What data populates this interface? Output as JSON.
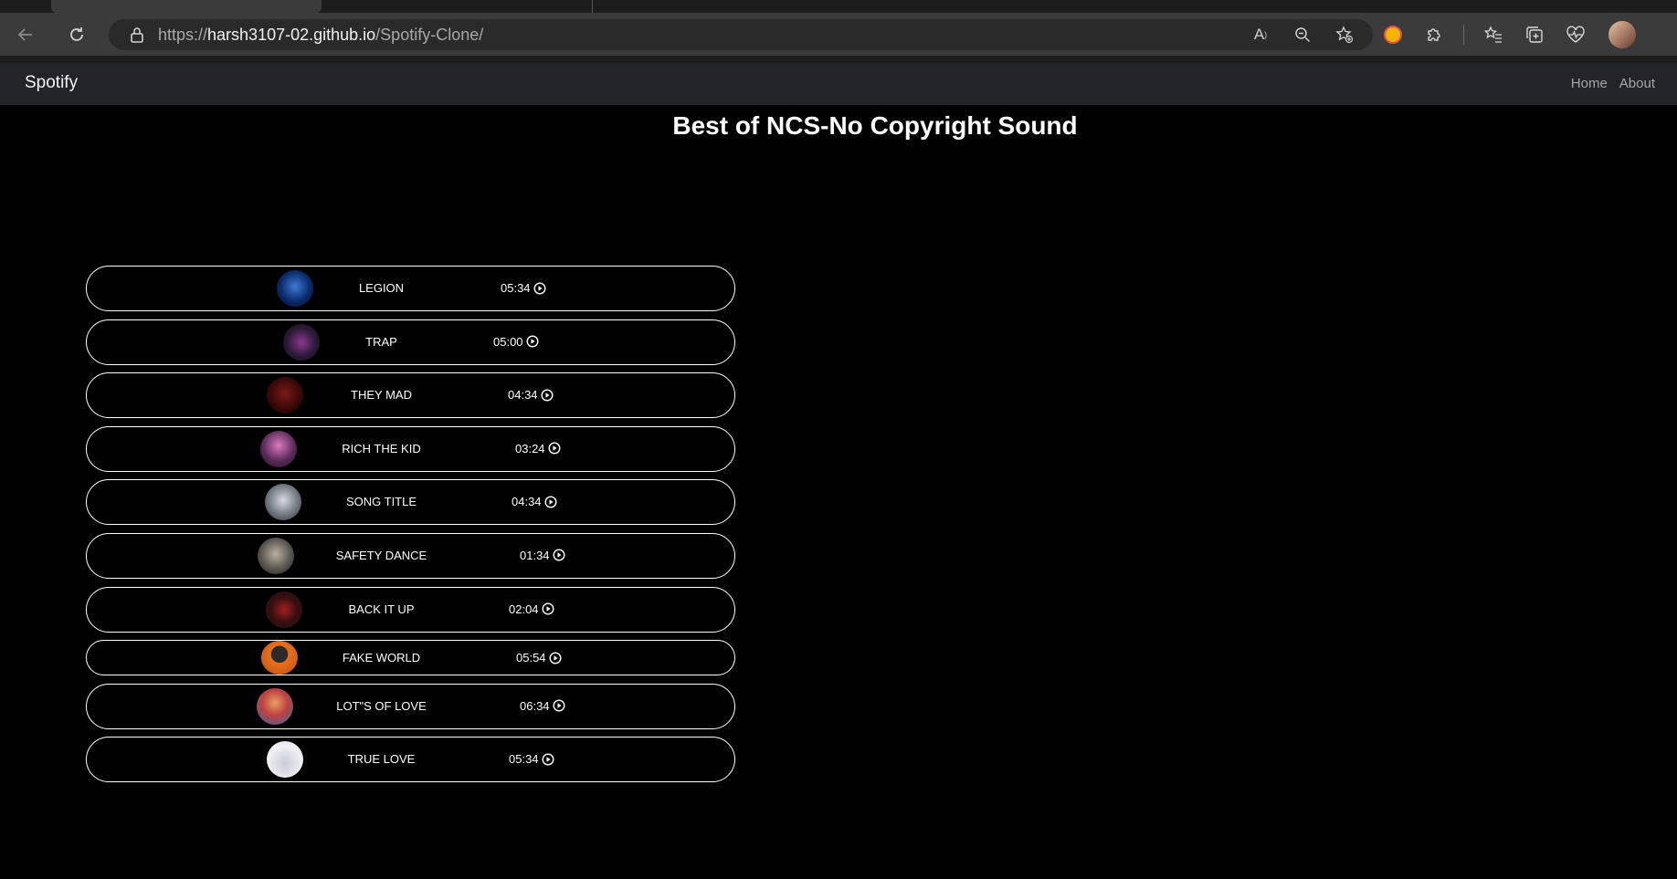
{
  "browser": {
    "url_prefix": "https://",
    "url_host": "harsh3107-02.github.io",
    "url_path": "/Spotify-Clone/"
  },
  "nav": {
    "brand": "Spotify",
    "links": [
      "Home",
      "About"
    ]
  },
  "main": {
    "title": "Best of NCS-No Copyright Sound"
  },
  "songs": [
    {
      "name": "LEGION",
      "time": "05:34"
    },
    {
      "name": "TRAP",
      "time": "05:00"
    },
    {
      "name": "THEY MAD",
      "time": "04:34"
    },
    {
      "name": "RICH THE KID",
      "time": "03:24"
    },
    {
      "name": "SONG TITLE",
      "time": "04:34"
    },
    {
      "name": "SAFETY DANCE",
      "time": "01:34"
    },
    {
      "name": "BACK IT UP",
      "time": "02:04"
    },
    {
      "name": "FAKE WORLD",
      "time": "05:54"
    },
    {
      "name": "LOT\"S OF LOVE",
      "time": "06:34"
    },
    {
      "name": "TRUE LOVE",
      "time": "05:34"
    }
  ],
  "colors": {
    "background": "#000000",
    "navbar": "#212529",
    "browser_toolbar": "#3b3b3b",
    "addressbar": "#2a2a2a"
  }
}
